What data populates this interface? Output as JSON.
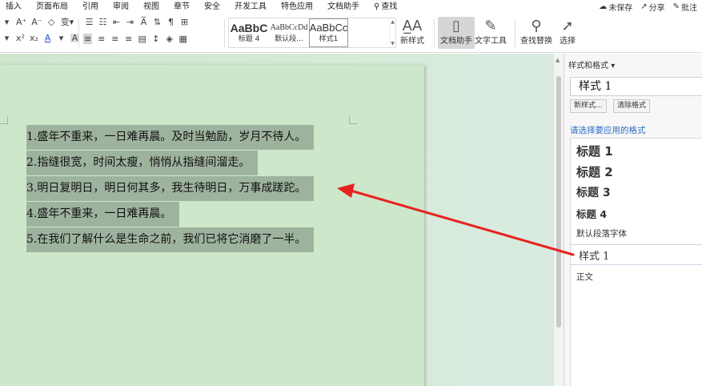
{
  "menu": {
    "items": [
      "插入",
      "页面布局",
      "引用",
      "审阅",
      "视图",
      "章节",
      "安全",
      "开发工具",
      "特色应用",
      "文档助手"
    ],
    "search_label": "查找",
    "right": {
      "unsaved": "未保存",
      "share": "分享",
      "comment": "批注"
    }
  },
  "ribbon": {
    "style_gallery": [
      {
        "preview": "AaBbC",
        "name": "标题 4"
      },
      {
        "preview": "AaBbCcDd",
        "name": "默认段..."
      },
      {
        "preview": "AaBbCc",
        "name": "样式1"
      }
    ],
    "new_style_label": "新样式",
    "doc_assistant_label": "文档助手",
    "text_tools_label": "文字工具",
    "find_replace_label": "查找替换",
    "select_label": "选择"
  },
  "document": {
    "lines": [
      "1.盛年不重来，一日难再晨。及时当勉励，岁月不待人。",
      "2.指缝很宽，时间太瘦，悄悄从指缝间溜走。",
      "3.明日复明日，明日何其多，我生待明日，万事成蹉跎。",
      "4.盛年不重来，一日难再晨。",
      "5.在我们了解什么是生命之前，我们已将它消磨了一半。"
    ]
  },
  "panel": {
    "title": "样式和格式",
    "current_style": "样式 1",
    "new_style_btn": "新样式...",
    "clear_format_btn": "清除格式",
    "apply_label": "请选择要应用的格式",
    "styles": [
      "标题  1",
      "标题  2",
      "标题  3",
      "标题  4",
      "默认段落字体",
      "样式 1",
      "正文"
    ]
  },
  "colors": {
    "accent_blue": "#2d6bc4",
    "arrow": "#e8231f",
    "doc_bg": "#cde7cb",
    "highlight": "#9eb39e"
  }
}
